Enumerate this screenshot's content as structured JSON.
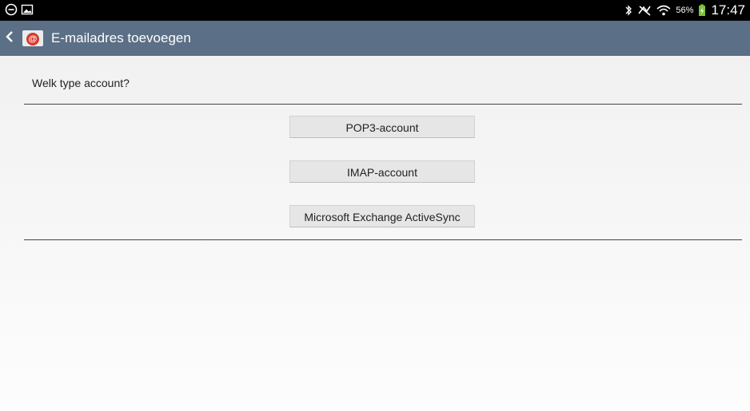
{
  "status_bar": {
    "battery_percent": "56%",
    "time": "17:47",
    "icons": [
      "do-not-disturb-icon",
      "gallery-notification-icon",
      "bluetooth-icon",
      "muted-icon",
      "wifi-icon",
      "battery-charging-icon"
    ]
  },
  "app_bar": {
    "title": "E-mailadres toevoegen",
    "back_icon": "chevron-left-icon",
    "app_icon": "email-app-icon"
  },
  "main": {
    "question": "Welk type account?",
    "options": [
      {
        "label": "POP3-account"
      },
      {
        "label": "IMAP-account"
      },
      {
        "label": "Microsoft Exchange ActiveSync"
      }
    ]
  }
}
